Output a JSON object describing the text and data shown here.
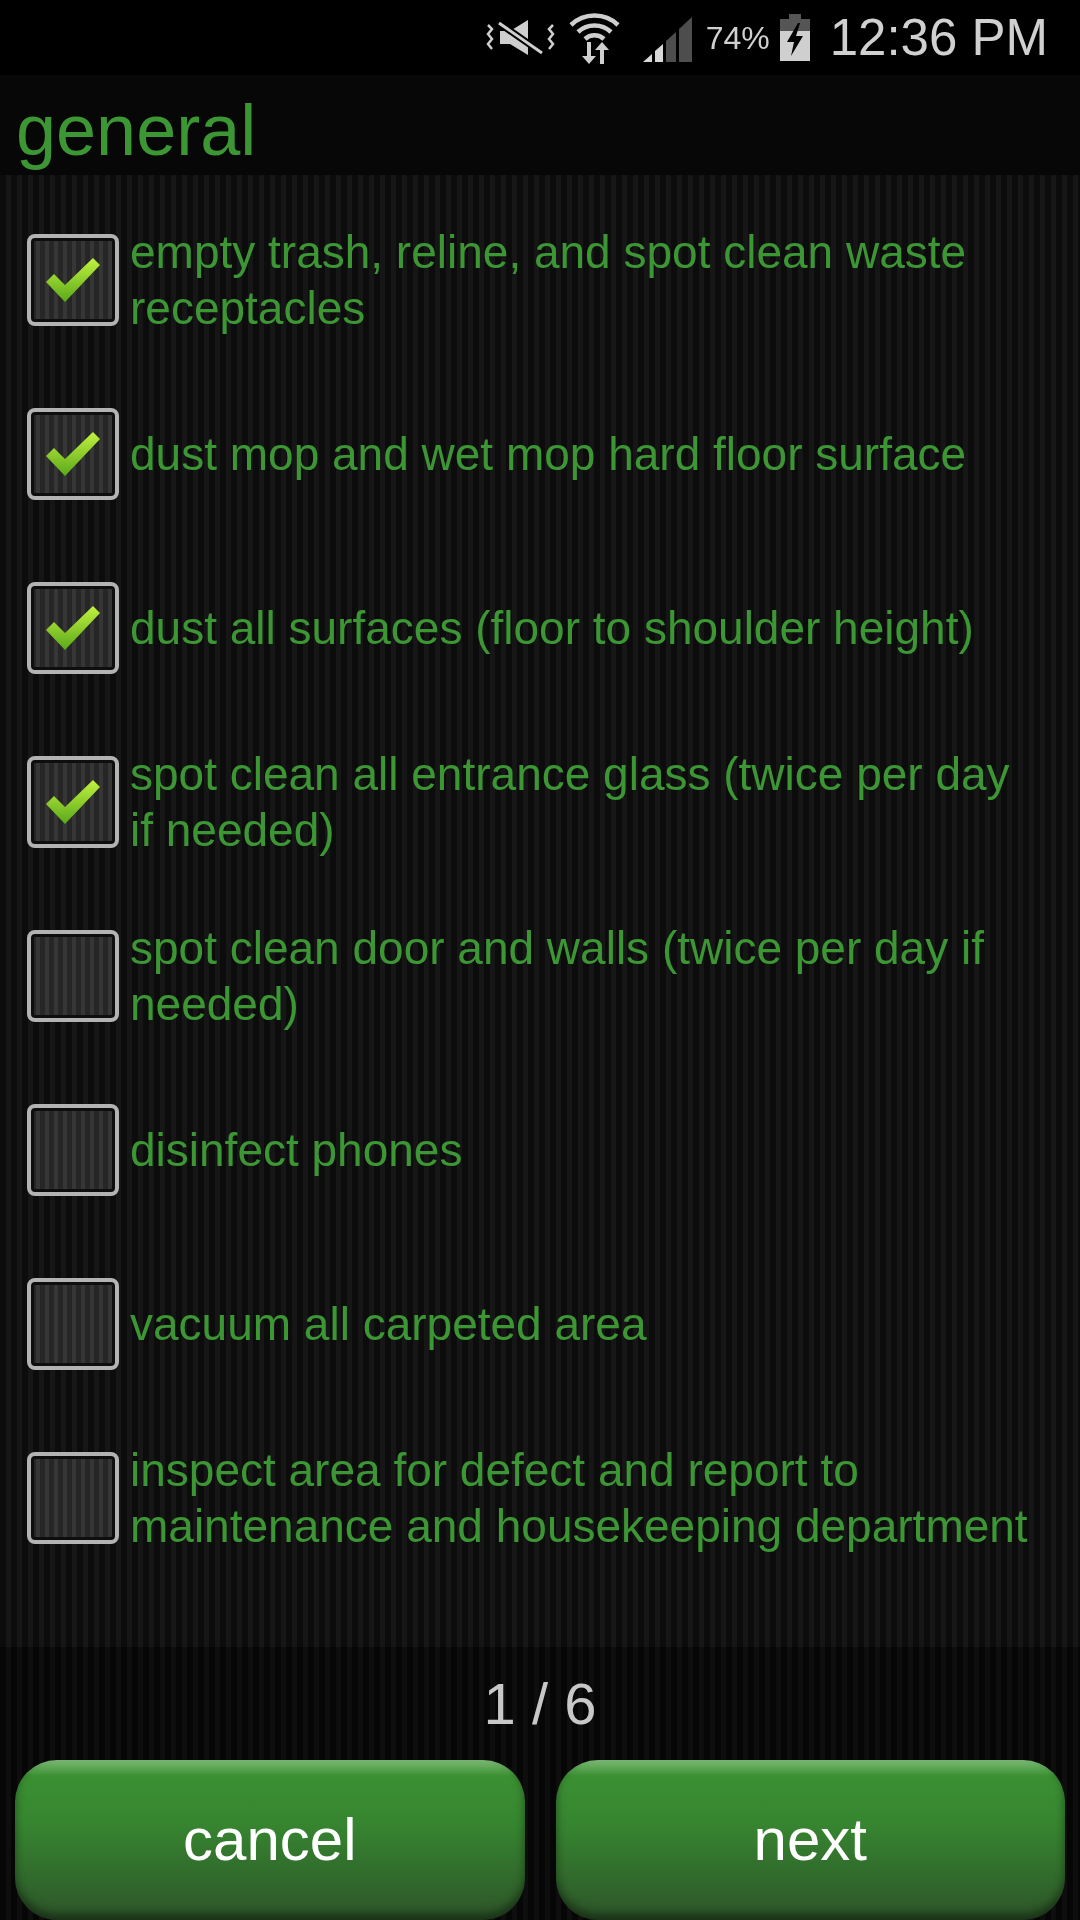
{
  "status_bar": {
    "battery": "74%",
    "time": "12:36 PM"
  },
  "header": {
    "title": "general"
  },
  "items": [
    {
      "label": "empty trash, reline, and spot clean waste receptacles",
      "checked": true
    },
    {
      "label": "dust mop and wet mop hard floor surface",
      "checked": true
    },
    {
      "label": "dust all surfaces (floor to shoulder height)",
      "checked": true
    },
    {
      "label": "spot clean all entrance glass (twice per day if needed)",
      "checked": true
    },
    {
      "label": "spot clean door and walls (twice per day if needed)",
      "checked": false
    },
    {
      "label": "disinfect phones",
      "checked": false
    },
    {
      "label": "vacuum all carpeted area",
      "checked": false
    },
    {
      "label": "inspect area for defect and report to maintenance and housekeeping department",
      "checked": false
    }
  ],
  "pager": {
    "text": "1 / 6"
  },
  "buttons": [
    "cancel",
    "next"
  ]
}
